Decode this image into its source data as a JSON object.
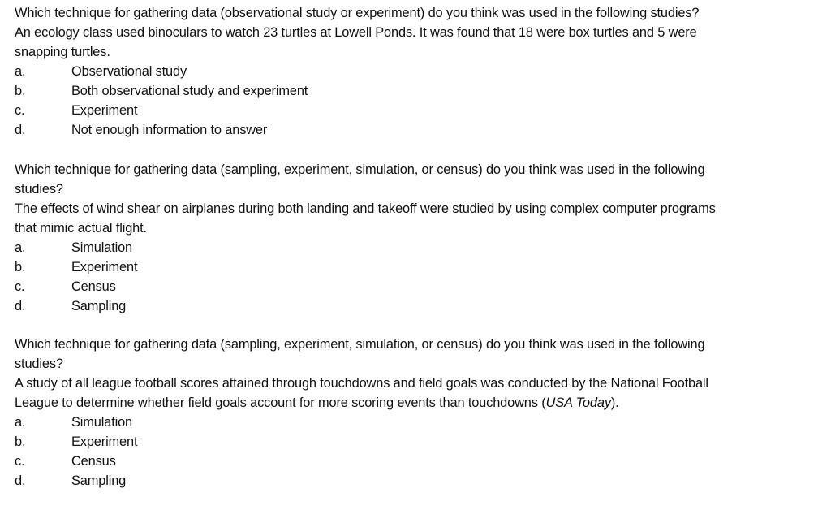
{
  "questions": [
    {
      "prompt_lines": [
        "Which technique for gathering data (observational study or experiment) do you think was used in the following studies?",
        "An ecology class used binoculars to watch 23 turtles at Lowell Ponds. It was found that 18 were box turtles and 5 were",
        "snapping turtles."
      ],
      "options": [
        {
          "letter": "a.",
          "text": "Observational study"
        },
        {
          "letter": "b.",
          "text": "Both observational study and experiment"
        },
        {
          "letter": "c.",
          "text": "Experiment"
        },
        {
          "letter": "d.",
          "text": "Not enough information to answer"
        }
      ]
    },
    {
      "prompt_lines": [
        "Which technique for gathering data (sampling, experiment, simulation, or census) do you think was used in the following",
        "studies?",
        "The effects of wind shear on airplanes during both landing and takeoff were studied by using complex computer programs",
        "that mimic actual flight."
      ],
      "options": [
        {
          "letter": "a.",
          "text": "Simulation"
        },
        {
          "letter": "b.",
          "text": "Experiment"
        },
        {
          "letter": "c.",
          "text": "Census"
        },
        {
          "letter": "d.",
          "text": "Sampling"
        }
      ]
    },
    {
      "prompt_lines": [
        "Which technique for gathering data (sampling, experiment, simulation, or census) do you think was used in the following",
        "studies?",
        "A study of all league football scores attained through touchdowns and field goals was conducted by the National Football"
      ],
      "prompt_last_line": {
        "before": "League to determine whether field goals account for more scoring events than touchdowns (",
        "italic": "USA Today",
        "after": ")."
      },
      "options": [
        {
          "letter": "a.",
          "text": "Simulation"
        },
        {
          "letter": "b.",
          "text": "Experiment"
        },
        {
          "letter": "c.",
          "text": "Census"
        },
        {
          "letter": "d.",
          "text": "Sampling"
        }
      ]
    }
  ]
}
